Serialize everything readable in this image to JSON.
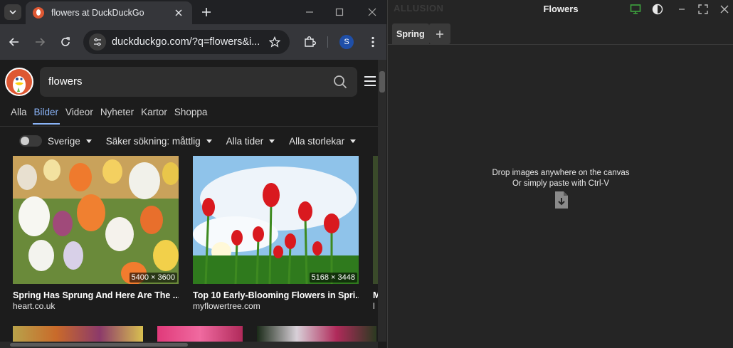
{
  "browser": {
    "tab_title": "flowers at DuckDuckGo",
    "url": "duckduckgo.com/?q=flowers&i...",
    "profile_initial": "S"
  },
  "ddg": {
    "query": "flowers",
    "tabs": [
      "Alla",
      "Bilder",
      "Videor",
      "Nyheter",
      "Kartor",
      "Shoppa"
    ],
    "active_tab": "Bilder",
    "filters": {
      "region": "Sverige",
      "safe_search": "Säker sökning: måttlig",
      "time": "Alla tider",
      "size": "Alla storlekar"
    },
    "results": [
      {
        "title": "Spring Has Sprung And Here Are The ...",
        "source": "heart.co.uk",
        "dims": "5400 × 3600"
      },
      {
        "title": "Top 10 Early-Blooming Flowers in Spri...",
        "source": "myflowertree.com",
        "dims": "5168 × 3448"
      },
      {
        "title": "M",
        "source": "l",
        "dims": ""
      }
    ]
  },
  "app": {
    "brand": "ALLUSION",
    "title": "Flowers",
    "tab_label": "Spring",
    "drop_line1": "Drop images anywhere on the canvas",
    "drop_line2": "Or simply paste with Ctrl-V"
  },
  "colors": {
    "ddg_orange": "#de5833",
    "link_blue": "#8ab4f8",
    "monitor_green": "#3ea33e"
  }
}
